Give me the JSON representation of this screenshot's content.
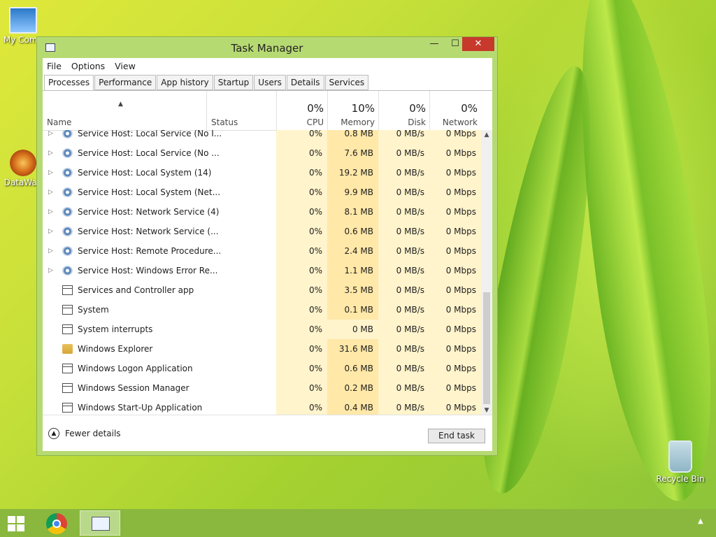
{
  "desktop": {
    "icons": [
      {
        "label": "My Comp"
      },
      {
        "label": "DataWag"
      },
      {
        "label": "Recycle Bin"
      }
    ]
  },
  "window": {
    "title": "Task Manager",
    "controls": {
      "minimize": "—",
      "maximize": "☐",
      "close": "✕"
    },
    "menu": [
      "File",
      "Options",
      "View"
    ],
    "tabs": [
      "Processes",
      "Performance",
      "App history",
      "Startup",
      "Users",
      "Details",
      "Services"
    ],
    "active_tab": "Processes"
  },
  "columns": {
    "name": "Name",
    "status": "Status",
    "cpu": {
      "percent": "0%",
      "label": "CPU"
    },
    "memory": {
      "percent": "10%",
      "label": "Memory"
    },
    "disk": {
      "percent": "0%",
      "label": "Disk"
    },
    "network": {
      "percent": "0%",
      "label": "Network"
    },
    "sort_glyph": "▲"
  },
  "rows": [
    {
      "expand": "▷",
      "icon": "gear",
      "name": "Service Host: Local Service (No I...",
      "cpu": "0%",
      "mem": "0.8 MB",
      "disk": "0 MB/s",
      "net": "0 Mbps"
    },
    {
      "expand": "▷",
      "icon": "gear",
      "name": "Service Host: Local Service (No ...",
      "cpu": "0%",
      "mem": "7.6 MB",
      "disk": "0 MB/s",
      "net": "0 Mbps"
    },
    {
      "expand": "▷",
      "icon": "gear",
      "name": "Service Host: Local System (14)",
      "cpu": "0%",
      "mem": "19.2 MB",
      "disk": "0 MB/s",
      "net": "0 Mbps"
    },
    {
      "expand": "▷",
      "icon": "gear",
      "name": "Service Host: Local System (Net...",
      "cpu": "0%",
      "mem": "9.9 MB",
      "disk": "0 MB/s",
      "net": "0 Mbps"
    },
    {
      "expand": "▷",
      "icon": "gear",
      "name": "Service Host: Network Service (4)",
      "cpu": "0%",
      "mem": "8.1 MB",
      "disk": "0 MB/s",
      "net": "0 Mbps"
    },
    {
      "expand": "▷",
      "icon": "gear",
      "name": "Service Host: Network Service (...",
      "cpu": "0%",
      "mem": "0.6 MB",
      "disk": "0 MB/s",
      "net": "0 Mbps"
    },
    {
      "expand": "▷",
      "icon": "gear",
      "name": "Service Host: Remote Procedure...",
      "cpu": "0%",
      "mem": "2.4 MB",
      "disk": "0 MB/s",
      "net": "0 Mbps"
    },
    {
      "expand": "▷",
      "icon": "gear",
      "name": "Service Host: Windows Error Re...",
      "cpu": "0%",
      "mem": "1.1 MB",
      "disk": "0 MB/s",
      "net": "0 Mbps"
    },
    {
      "expand": "",
      "icon": "app",
      "name": "Services and Controller app",
      "cpu": "0%",
      "mem": "3.5 MB",
      "disk": "0 MB/s",
      "net": "0 Mbps"
    },
    {
      "expand": "",
      "icon": "app",
      "name": "System",
      "cpu": "0%",
      "mem": "0.1 MB",
      "disk": "0 MB/s",
      "net": "0 Mbps"
    },
    {
      "expand": "",
      "icon": "app",
      "name": "System interrupts",
      "cpu": "0%",
      "mem": "0 MB",
      "disk": "0 MB/s",
      "net": "0 Mbps"
    },
    {
      "expand": "",
      "icon": "folder",
      "name": "Windows Explorer",
      "cpu": "0%",
      "mem": "31.6 MB",
      "disk": "0 MB/s",
      "net": "0 Mbps"
    },
    {
      "expand": "",
      "icon": "app",
      "name": "Windows Logon Application",
      "cpu": "0%",
      "mem": "0.6 MB",
      "disk": "0 MB/s",
      "net": "0 Mbps"
    },
    {
      "expand": "",
      "icon": "app",
      "name": "Windows Session Manager",
      "cpu": "0%",
      "mem": "0.2 MB",
      "disk": "0 MB/s",
      "net": "0 Mbps"
    },
    {
      "expand": "",
      "icon": "app",
      "name": "Windows Start-Up Application",
      "cpu": "0%",
      "mem": "0.4 MB",
      "disk": "0 MB/s",
      "net": "0 Mbps"
    }
  ],
  "footer": {
    "fewer_details": "Fewer details",
    "fewer_glyph": "▲",
    "end_task": "End task"
  },
  "scrollbar": {
    "up": "▲",
    "down": "▼"
  },
  "taskbar": {
    "tray_arrow": "▲"
  },
  "colors": {
    "accent_close": "#c7392b",
    "heat_light": "#fff4cc",
    "heat_medium": "#ffe8a8",
    "window_frame": "#b6da72",
    "taskbar": "#8ab83f"
  }
}
